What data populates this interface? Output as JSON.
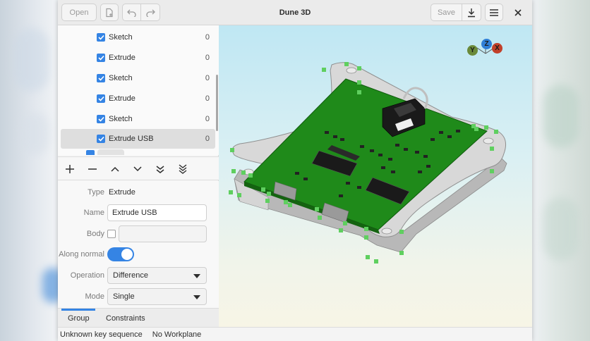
{
  "window": {
    "title": "Dune 3D"
  },
  "header": {
    "open_label": "Open",
    "save_label": "Save",
    "icons": [
      "new-document-icon",
      "undo-icon",
      "redo-icon",
      "export-download-icon",
      "hamburger-menu-icon",
      "close-icon"
    ]
  },
  "tree": {
    "items": [
      {
        "label": "Sketch",
        "count": "0",
        "checked": true
      },
      {
        "label": "Extrude",
        "count": "0",
        "checked": true
      },
      {
        "label": "Sketch",
        "count": "0",
        "checked": true
      },
      {
        "label": "Extrude",
        "count": "0",
        "checked": true
      },
      {
        "label": "Sketch",
        "count": "0",
        "checked": true
      },
      {
        "label": "Extrude USB",
        "count": "0",
        "checked": true,
        "selected": true
      }
    ]
  },
  "toolbar": {
    "icons": [
      "add-icon",
      "remove-icon",
      "move-up-icon",
      "move-down-icon",
      "move-to-end-icon",
      "move-to-bottom-icon"
    ]
  },
  "properties": {
    "type_label": "Type",
    "type_value": "Extrude",
    "name_label": "Name",
    "name_value": "Extrude USB",
    "body_label": "Body",
    "body_value": "",
    "along_normal_label": "Along normal",
    "along_normal_on": true,
    "operation_label": "Operation",
    "operation_value": "Difference",
    "mode_label": "Mode",
    "mode_value": "Single"
  },
  "tabs": [
    {
      "label": "Group",
      "active": true
    },
    {
      "label": "Constraints",
      "active": false
    }
  ],
  "status": {
    "message": "Unknown key sequence",
    "workplane": "No Workplane"
  },
  "axes": {
    "y": "Y",
    "z": "Z",
    "x": "X",
    "colors": {
      "y": "#6a8a3a",
      "z": "#2f7fd6",
      "x": "#c2402a"
    }
  },
  "colors": {
    "accent": "#3584e4",
    "pcb": "#1f8a1a",
    "case": "#c9c9c9",
    "constraint_points": "#5fcf5f"
  }
}
